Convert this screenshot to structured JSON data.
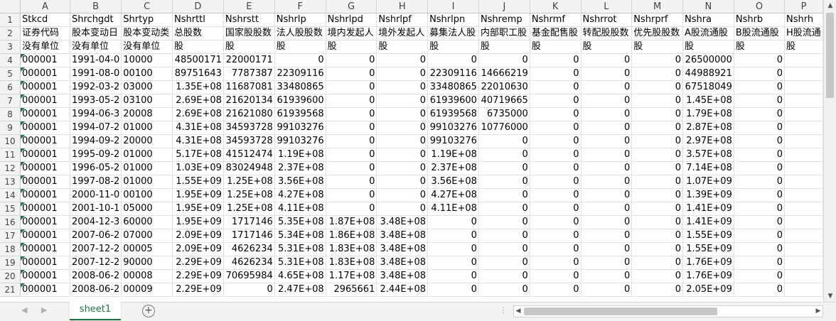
{
  "columns": [
    "A",
    "B",
    "C",
    "D",
    "E",
    "F",
    "G",
    "H",
    "I",
    "J",
    "K",
    "L",
    "M",
    "N",
    "O",
    "P"
  ],
  "row_numbers": [
    "1",
    "2",
    "3",
    "4",
    "5",
    "6",
    "7",
    "8",
    "9",
    "10",
    "11",
    "12",
    "13",
    "14",
    "15",
    "16",
    "17",
    "18",
    "19",
    "20",
    "21"
  ],
  "rows": [
    [
      "Stkcd",
      "Shrchgdt",
      "Shrtyp",
      "Nshrttl",
      "Nshrstt",
      "Nshrlp",
      "Nshrlpd",
      "Nshrlpf",
      "Nshrlpn",
      "Nshremp",
      "Nshrmf",
      "Nshrrot",
      "Nshrprf",
      "Nshra",
      "Nshrb",
      "Nshrh"
    ],
    [
      "证券代码",
      "股本变动日",
      "股本变动类",
      "总股数",
      "国家股股数",
      "法人股股数",
      "境内发起人",
      "境外发起人",
      "募集法人股",
      "内部职工股",
      "基金配售股",
      "转配股股数",
      "优先股股数",
      "A股流通股",
      "B股流通股",
      "H股流通"
    ],
    [
      "没有单位",
      "没有单位",
      "没有单位",
      "股",
      "股",
      "股",
      "股",
      "股",
      "股",
      "股",
      "股",
      "股",
      "股",
      "股",
      "股",
      "股"
    ],
    [
      "000001",
      "1991-04-0",
      "10000",
      "48500171",
      "22000171",
      "0",
      "0",
      "0",
      "0",
      "0",
      "0",
      "0",
      "0",
      "26500000",
      "0",
      ""
    ],
    [
      "000001",
      "1991-08-0",
      "00100",
      "89751643",
      "7787387",
      "22309116",
      "0",
      "0",
      "22309116",
      "14666219",
      "0",
      "0",
      "0",
      "44988921",
      "0",
      ""
    ],
    [
      "000001",
      "1992-03-2",
      "03000",
      "1.35E+08",
      "11687081",
      "33480865",
      "0",
      "0",
      "33480865",
      "22010630",
      "0",
      "0",
      "0",
      "67518049",
      "0",
      ""
    ],
    [
      "000001",
      "1993-05-2",
      "03100",
      "2.69E+08",
      "21620134",
      "61939600",
      "0",
      "0",
      "61939600",
      "40719665",
      "0",
      "0",
      "0",
      "1.45E+08",
      "0",
      ""
    ],
    [
      "000001",
      "1994-06-3",
      "20008",
      "2.69E+08",
      "21621080",
      "61939568",
      "0",
      "0",
      "61939568",
      "6735000",
      "0",
      "0",
      "0",
      "1.79E+08",
      "0",
      ""
    ],
    [
      "000001",
      "1994-07-2",
      "01000",
      "4.31E+08",
      "34593728",
      "99103276",
      "0",
      "0",
      "99103276",
      "10776000",
      "0",
      "0",
      "0",
      "2.87E+08",
      "0",
      ""
    ],
    [
      "000001",
      "1994-09-2",
      "20000",
      "4.31E+08",
      "34593728",
      "99103276",
      "0",
      "0",
      "99103276",
      "0",
      "0",
      "0",
      "0",
      "2.97E+08",
      "0",
      ""
    ],
    [
      "000001",
      "1995-09-2",
      "01000",
      "5.17E+08",
      "41512474",
      "1.19E+08",
      "0",
      "0",
      "1.19E+08",
      "0",
      "0",
      "0",
      "0",
      "3.57E+08",
      "0",
      ""
    ],
    [
      "000001",
      "1996-05-2",
      "01000",
      "1.03E+09",
      "83024948",
      "2.37E+08",
      "0",
      "0",
      "2.37E+08",
      "0",
      "0",
      "0",
      "0",
      "7.14E+08",
      "0",
      ""
    ],
    [
      "000001",
      "1997-08-2",
      "01000",
      "1.55E+09",
      "1.25E+08",
      "3.56E+08",
      "0",
      "0",
      "3.56E+08",
      "0",
      "0",
      "0",
      "0",
      "1.07E+09",
      "0",
      ""
    ],
    [
      "000001",
      "2000-11-0",
      "00100",
      "1.95E+09",
      "1.25E+08",
      "4.27E+08",
      "0",
      "0",
      "4.27E+08",
      "0",
      "0",
      "0",
      "0",
      "1.39E+09",
      "0",
      ""
    ],
    [
      "000001",
      "2001-10-1",
      "05000",
      "1.95E+09",
      "1.25E+08",
      "4.11E+08",
      "0",
      "0",
      "4.11E+08",
      "0",
      "0",
      "0",
      "0",
      "1.41E+09",
      "0",
      ""
    ],
    [
      "000001",
      "2004-12-3",
      "60000",
      "1.95E+09",
      "1717146",
      "5.35E+08",
      "1.87E+08",
      "3.48E+08",
      "0",
      "0",
      "0",
      "0",
      "0",
      "1.41E+09",
      "0",
      ""
    ],
    [
      "000001",
      "2007-06-2",
      "07000",
      "2.09E+09",
      "1717146",
      "5.34E+08",
      "1.86E+08",
      "3.48E+08",
      "0",
      "0",
      "0",
      "0",
      "0",
      "1.55E+09",
      "0",
      ""
    ],
    [
      "000001",
      "2007-12-2",
      "00005",
      "2.09E+09",
      "4626234",
      "5.31E+08",
      "1.83E+08",
      "3.48E+08",
      "0",
      "0",
      "0",
      "0",
      "0",
      "1.55E+09",
      "0",
      ""
    ],
    [
      "000001",
      "2007-12-2",
      "90000",
      "2.29E+09",
      "4626234",
      "5.31E+08",
      "1.83E+08",
      "3.48E+08",
      "0",
      "0",
      "0",
      "0",
      "0",
      "1.76E+09",
      "0",
      ""
    ],
    [
      "000001",
      "2008-06-2",
      "00008",
      "2.29E+09",
      "70695984",
      "4.65E+08",
      "1.17E+08",
      "3.48E+08",
      "0",
      "0",
      "0",
      "0",
      "0",
      "1.76E+09",
      "0",
      ""
    ],
    [
      "000001",
      "2008-06-2",
      "00009",
      "2.29E+09",
      "0",
      "2.47E+08",
      "2965661",
      "2.44E+08",
      "0",
      "0",
      "0",
      "0",
      "0",
      "2.05E+09",
      "0",
      ""
    ]
  ],
  "sheet_tab": "sheet1",
  "icons": {
    "prev_sheet": "◀",
    "next_sheet": "▶",
    "add_sheet": "+",
    "scroll_up": "▲",
    "scroll_down": "▼",
    "scroll_left": "◀",
    "scroll_right": "▶"
  },
  "colors": {
    "accent": "#217346",
    "header_bg": "#f3f3f3",
    "grid_line": "#e1e1e1"
  }
}
